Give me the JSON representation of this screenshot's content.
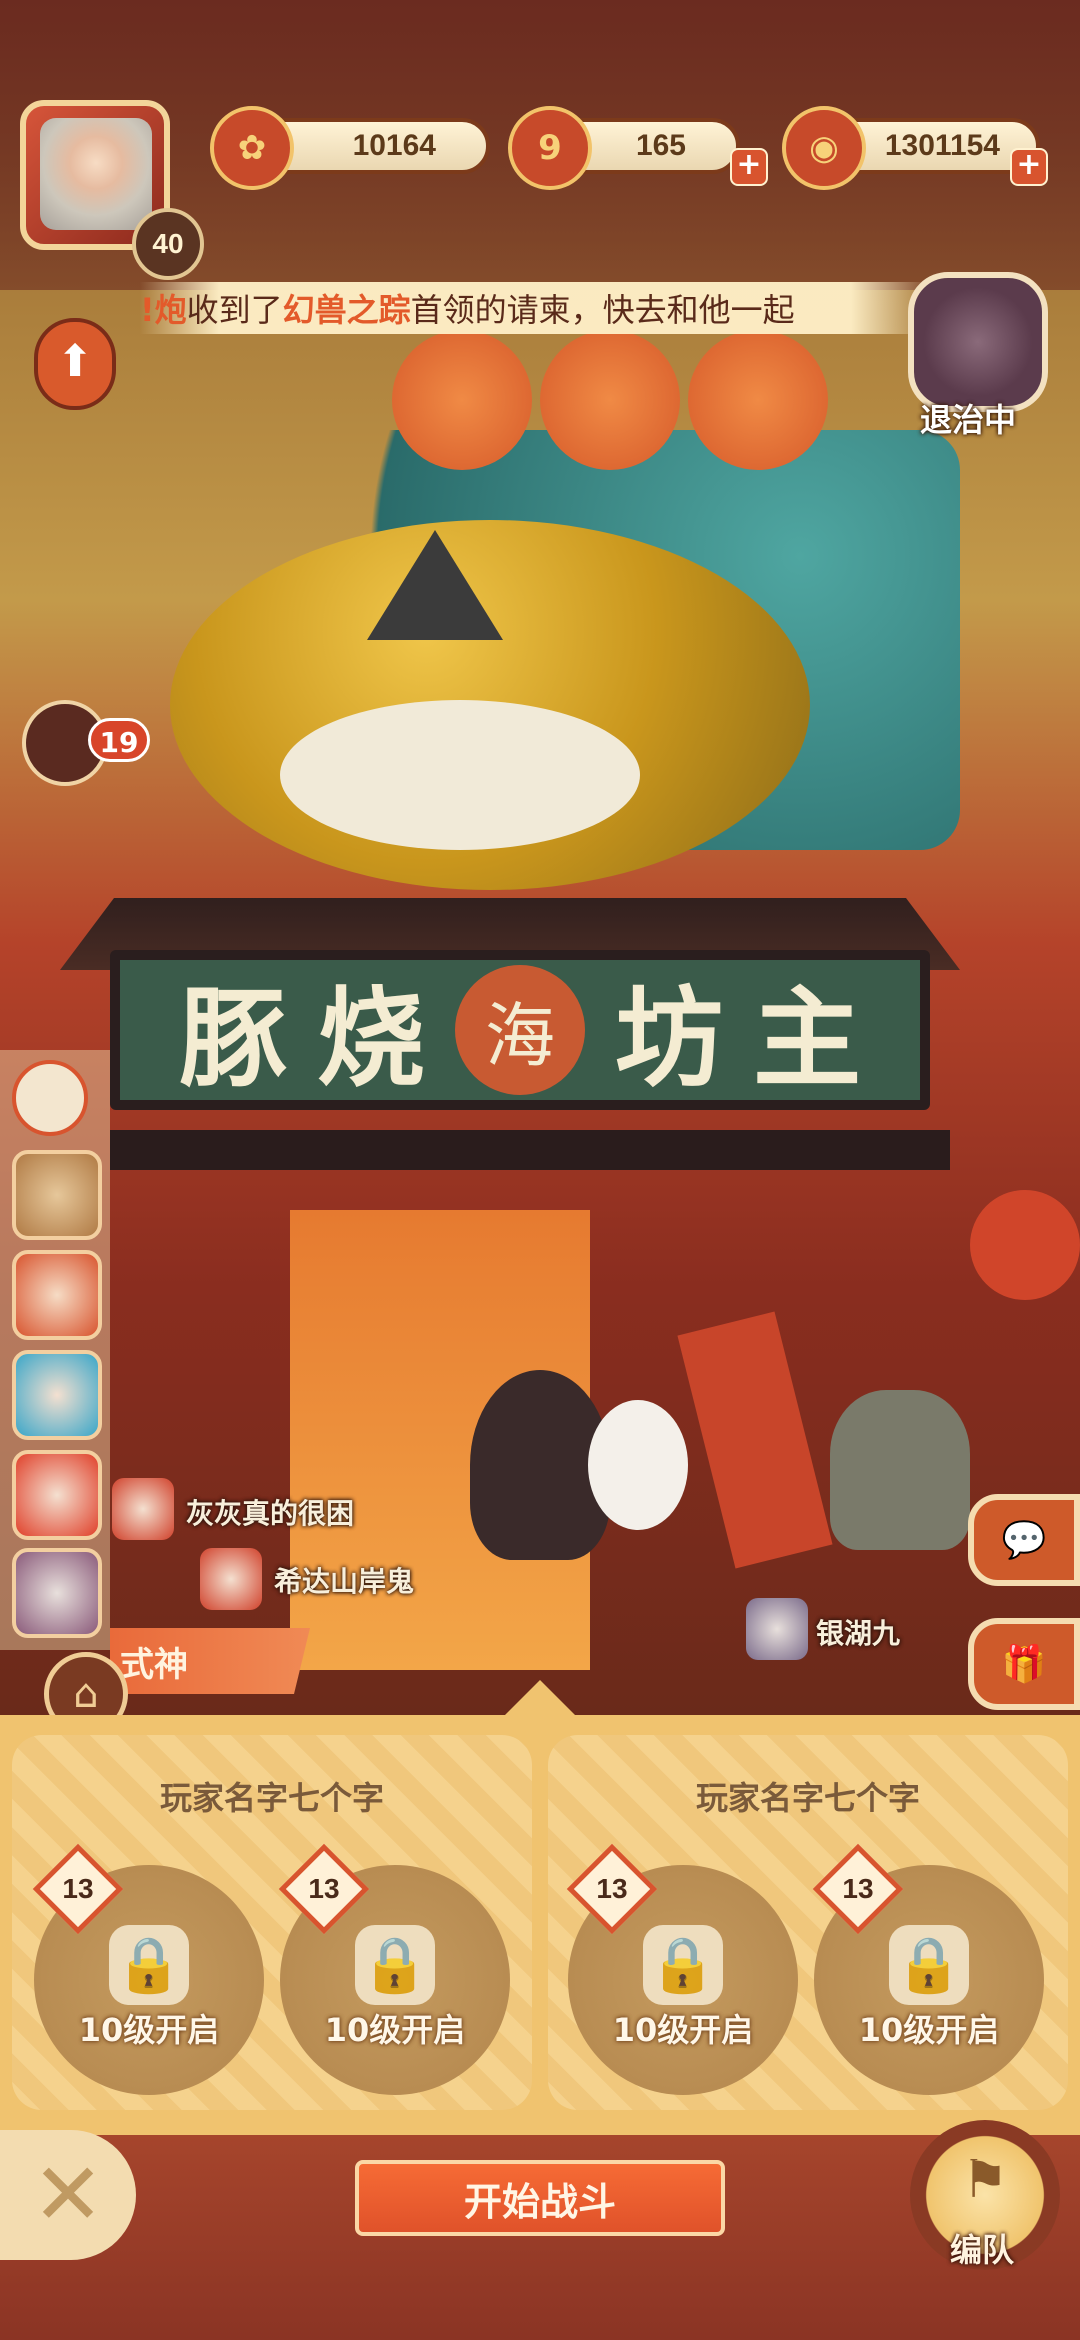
{
  "top": {
    "player_level": "40",
    "resources": [
      {
        "icon": "plum-blossom-icon",
        "value": "10164"
      },
      {
        "icon": "stamina-icon",
        "badge": "9",
        "value": "165"
      },
      {
        "icon": "coin-icon",
        "value": "1301154"
      }
    ],
    "plus": "+"
  },
  "notice": {
    "part1": "!炮",
    "part2": "收到了",
    "highlight": "幻兽之踪",
    "part3": "首领的请柬，快去和他一起"
  },
  "fort": {
    "label": "退治中"
  },
  "left_badge_count": "19",
  "sign": {
    "chars": [
      "豚",
      "烧",
      "坊",
      "主"
    ],
    "seal": "海"
  },
  "scene_players": [
    {
      "name": "灰灰真的很困"
    },
    {
      "name": "希达山岸鬼"
    },
    {
      "name": "银湖九"
    }
  ],
  "shishen_tab": "式神",
  "teams": [
    {
      "name": "玩家名字七个字",
      "slots": [
        {
          "level": "13",
          "text": "10级开启"
        },
        {
          "level": "13",
          "text": "10级开启"
        }
      ]
    },
    {
      "name": "玩家名字七个字",
      "slots": [
        {
          "level": "13",
          "text": "10级开启"
        },
        {
          "level": "13",
          "text": "10级开启"
        }
      ]
    }
  ],
  "buttons": {
    "start": "开始战斗",
    "formation": "编队",
    "close": "✕"
  },
  "colors": {
    "accent": "#e0522a",
    "panel": "#f0c36f",
    "bar": "#8b3424"
  }
}
